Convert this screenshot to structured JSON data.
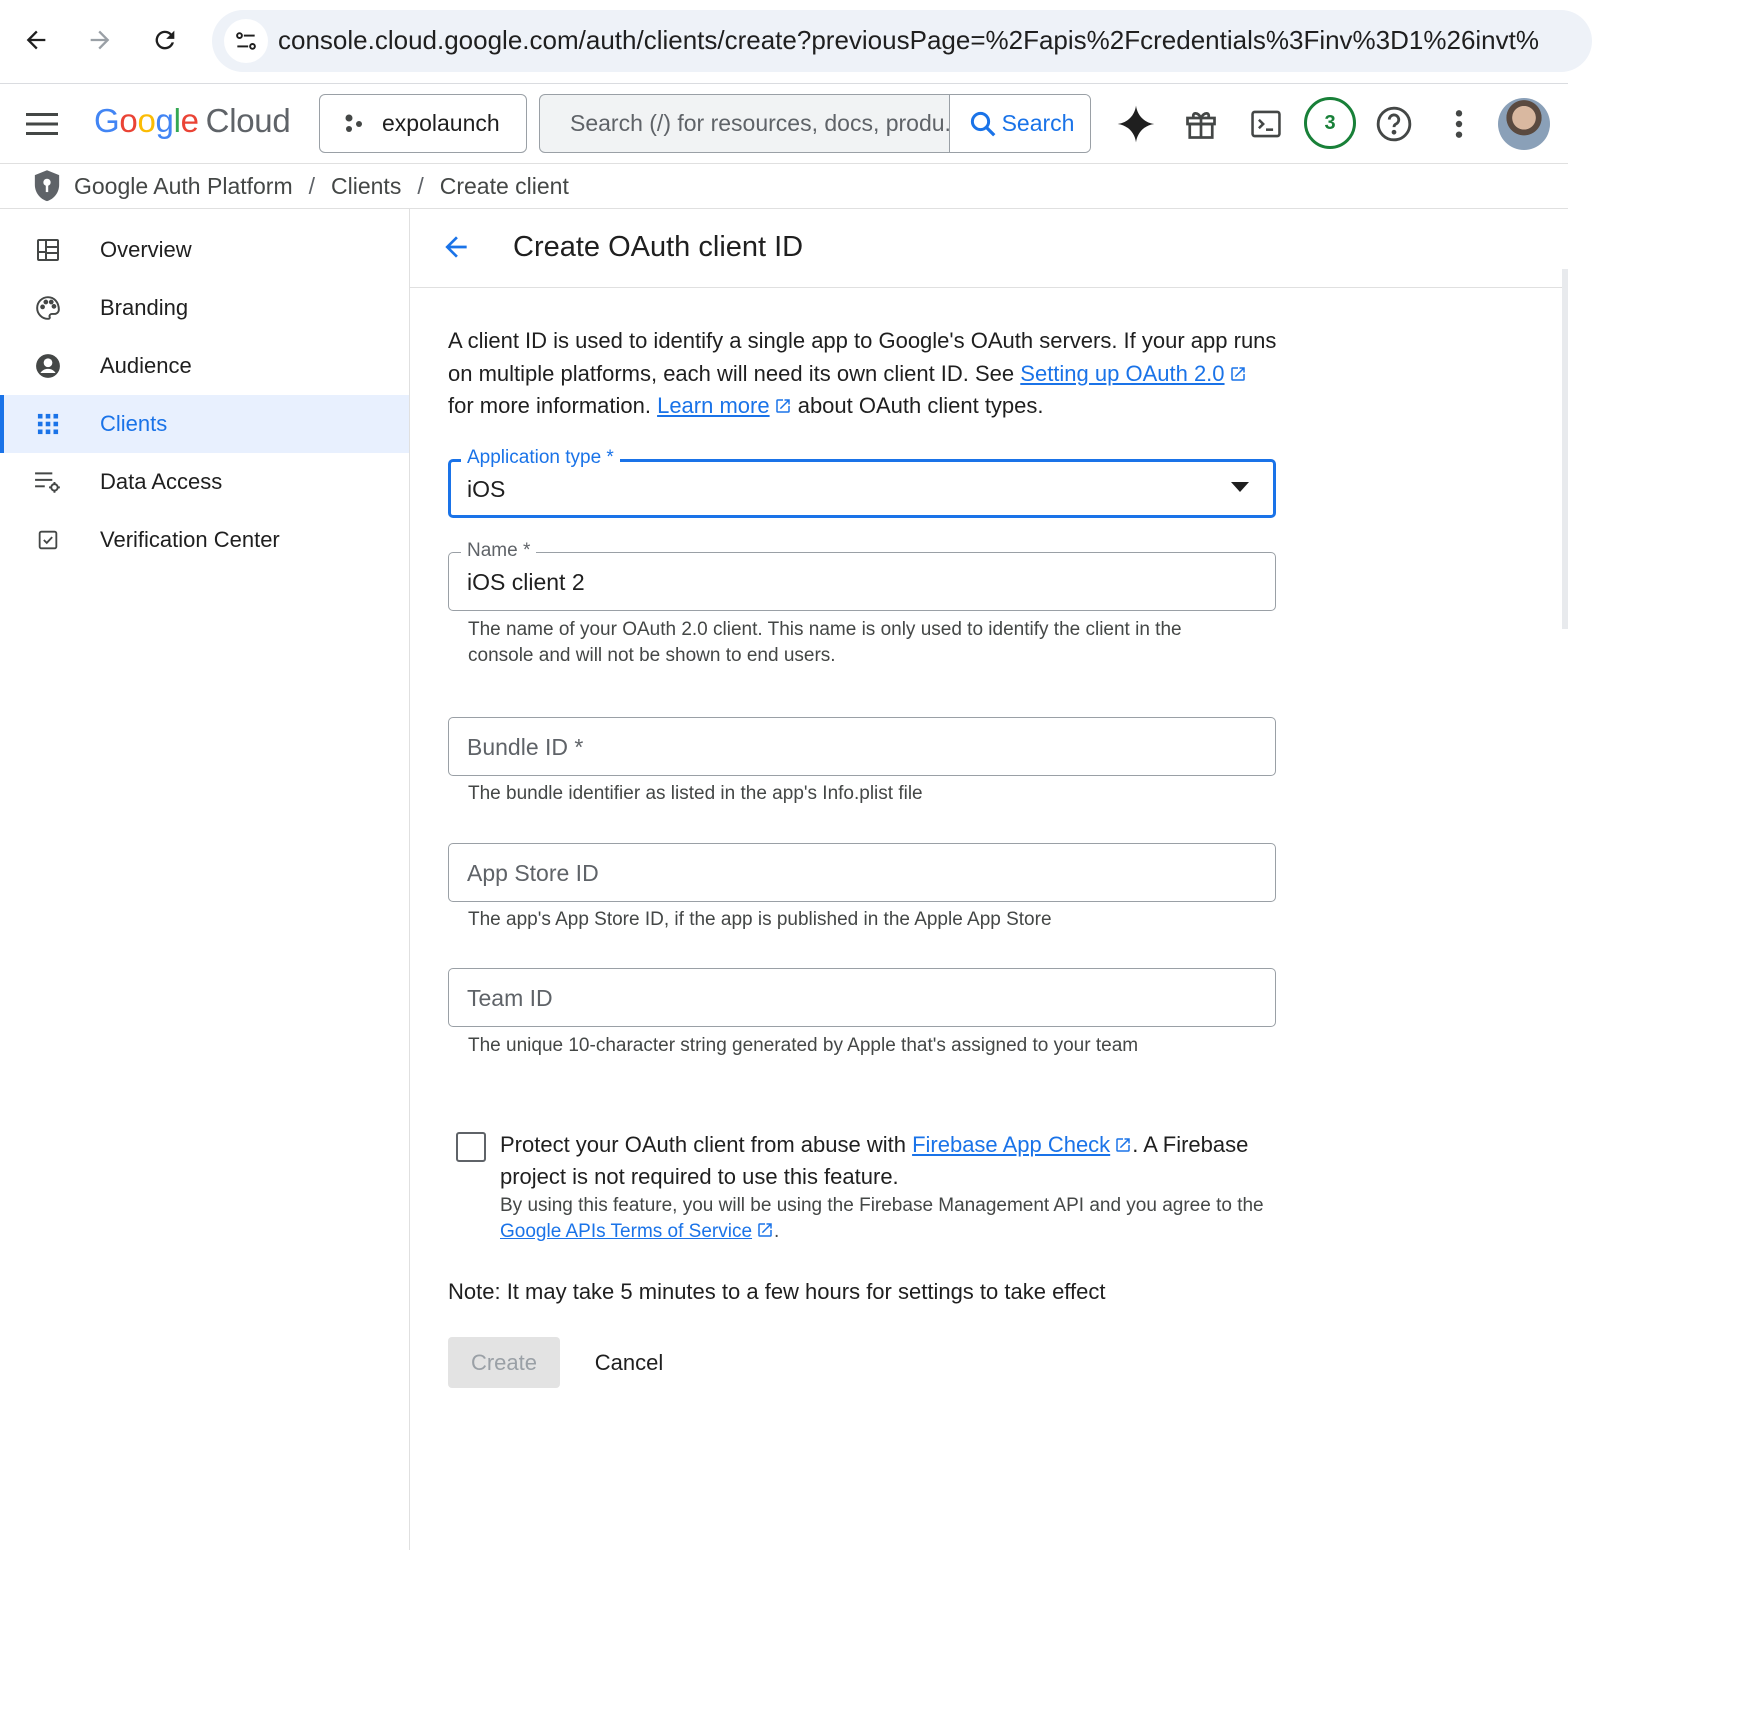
{
  "browser": {
    "url": "console.cloud.google.com/auth/clients/create?previousPage=%2Fapis%2Fcredentials%3Finv%3D1%26invt%"
  },
  "header": {
    "logo_google": [
      "G",
      "o",
      "o",
      "g",
      "l",
      "e"
    ],
    "logo_cloud": "Cloud",
    "project_name": "expolaunch",
    "search_placeholder": "Search (/) for resources, docs, produ...",
    "search_button": "Search",
    "notification_count": "3"
  },
  "breadcrumb": {
    "items": [
      "Google Auth Platform",
      "Clients",
      "Create client"
    ],
    "separator": "/"
  },
  "sidebar": {
    "items": [
      {
        "label": "Overview",
        "icon": "dashboard-icon"
      },
      {
        "label": "Branding",
        "icon": "palette-icon"
      },
      {
        "label": "Audience",
        "icon": "account-circle-icon"
      },
      {
        "label": "Clients",
        "icon": "apps-grid-icon",
        "active": true
      },
      {
        "label": "Data Access",
        "icon": "data-settings-icon"
      },
      {
        "label": "Verification Center",
        "icon": "checkbox-icon"
      }
    ]
  },
  "main": {
    "title": "Create OAuth client ID",
    "intro_part1": "A client ID is used to identify a single app to Google's OAuth servers. If your app runs on multiple platforms, each will need its own client ID. See ",
    "intro_link1": "Setting up OAuth 2.0",
    "intro_part2": " for more information. ",
    "intro_link2": "Learn more",
    "intro_part3": " about OAuth client types.",
    "app_type": {
      "label": "Application type *",
      "value": "iOS"
    },
    "name": {
      "label": "Name *",
      "value": "iOS client 2",
      "hint": "The name of your OAuth 2.0 client. This name is only used to identify the client in the console and will not be shown to end users."
    },
    "bundle_id": {
      "placeholder": "Bundle ID *",
      "hint": "The bundle identifier as listed in the app's Info.plist file"
    },
    "app_store_id": {
      "placeholder": "App Store ID",
      "hint": "The app's App Store ID, if the app is published in the Apple App Store"
    },
    "team_id": {
      "placeholder": "Team ID",
      "hint": "The unique 10-character string generated by Apple that's assigned to your team"
    },
    "app_check": {
      "text_part1": "Protect your OAuth client from abuse with ",
      "link": "Firebase App Check",
      "text_part2": ". A Firebase project is not required to use this feature.",
      "sub_part1": "By using this feature, you will be using the Firebase Management API and you agree to the ",
      "sub_link": "Google APIs Terms of Service",
      "sub_part2": ".",
      "checked": false
    },
    "note": "Note: It may take 5 minutes to a few hours for settings to take effect",
    "create_button": "Create",
    "cancel_button": "Cancel"
  },
  "colors": {
    "accent": "#1a73e8",
    "active_bg": "#e8f0fe",
    "badge": "#188038"
  }
}
